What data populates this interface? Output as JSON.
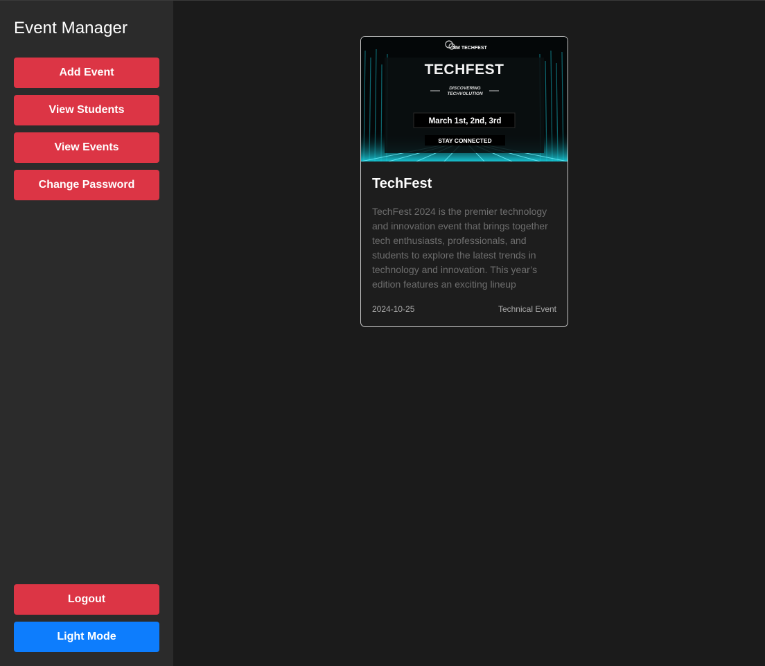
{
  "sidebar": {
    "brand": "Event Manager",
    "top_items": [
      {
        "label": "Add Event"
      },
      {
        "label": "View Students"
      },
      {
        "label": "View Events"
      },
      {
        "label": "Change Password"
      }
    ],
    "bottom_items": [
      {
        "label": "Logout"
      },
      {
        "label": "Light Mode"
      }
    ]
  },
  "colors": {
    "sidebar_bg": "#2b2b2b",
    "main_bg": "#1b1b1b",
    "danger_button": "#dc3545",
    "primary_button": "#0d7dfd",
    "banner_accent": "#18d8e8"
  },
  "events": [
    {
      "banner": {
        "logo_text": "NM TECHFEST",
        "headline": "TECHFEST",
        "tagline_line1": "DISCOVERING",
        "tagline_line2": "TECHVOLUTION",
        "dates": "March 1st, 2nd, 3rd",
        "cta": "STAY CONNECTED"
      },
      "title": "TechFest",
      "description": "TechFest 2024 is the premier technology and innovation event that brings together tech enthusiasts, professionals, and students to explore the latest trends in technology and innovation. This year’s edition features an exciting lineup",
      "date": "2024-10-25",
      "category": "Technical Event"
    }
  ]
}
